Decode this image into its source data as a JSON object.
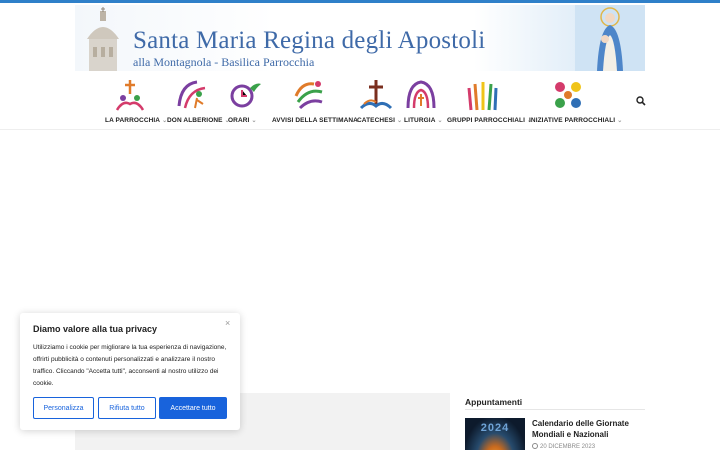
{
  "header": {
    "title": "Santa Maria Regina degli Apostoli",
    "subtitle": "alla Montagnola - Basilica Parrocchia"
  },
  "nav": {
    "items": [
      {
        "label": "LA PARROCCHIA",
        "icon": "family-cross-icon",
        "has_dropdown": true
      },
      {
        "label": "DON ALBERIONE",
        "icon": "alberione-icon",
        "has_dropdown": true
      },
      {
        "label": "ORARI",
        "icon": "clock-dove-icon",
        "has_dropdown": true
      },
      {
        "label": "AVVISI DELLA SETTIMANA",
        "icon": "announcement-icon",
        "has_dropdown": false
      },
      {
        "label": "CATECHESI",
        "icon": "cross-book-icon",
        "has_dropdown": true
      },
      {
        "label": "LITURGIA",
        "icon": "liturgy-icon",
        "has_dropdown": true
      },
      {
        "label": "GRUPPI PARROCCHIALI",
        "icon": "hands-icon",
        "has_dropdown": true
      },
      {
        "label": "INIZIATIVE PARROCCHIALI",
        "icon": "hearts-icon",
        "has_dropdown": true
      }
    ],
    "caret": "⌄"
  },
  "sidebar": {
    "widget_title": "Appuntamenti",
    "posts": [
      {
        "thumb_text": "2024",
        "title": "Calendario delle Giornate Mondiali e Nazionali",
        "date": "20 DICEMBRE 2023"
      }
    ]
  },
  "cookie": {
    "close": "×",
    "title": "Diamo valore alla tua privacy",
    "text": "Utilizziamo i cookie per migliorare la tua esperienza di navigazione, offrirti pubblicità o contenuti personalizzati e analizzare il nostro traffico. Cliccando \"Accetta tutti\", acconsenti al nostro utilizzo dei cookie.",
    "customize_label": "Personalizza",
    "reject_label": "Rifiuta tutto",
    "accept_label": "Accettare tutto"
  },
  "colors": {
    "accent": "#1863dc",
    "banner_text": "#3f6aa8",
    "top_bar": "#2f80c9"
  }
}
